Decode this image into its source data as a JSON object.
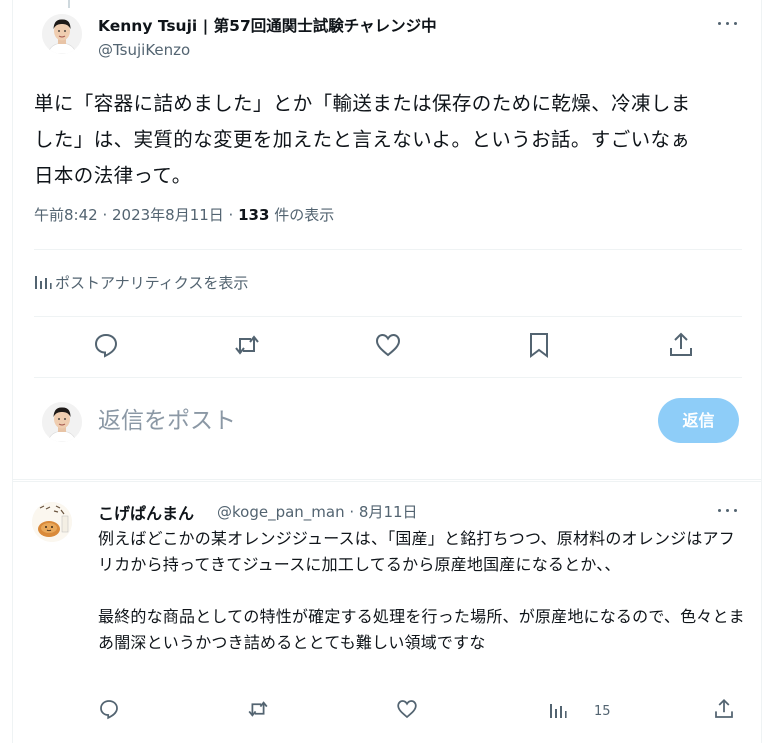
{
  "main_tweet": {
    "author_name": "Kenny Tsuji | 第57回通関士試験チャレンジ中",
    "author_handle": "@TsujiKenzo",
    "more_icon": "ellipsis-icon",
    "text_lines": [
      "単に「容器に詰めました」とか「輸送または保存のために乾燥、冷凍しま",
      "した」は、実質的な変更を加えたと言えないよ。というお話。すごいなぁ",
      "日本の法律って。"
    ],
    "time": "午前8:42 · 2023年8月11日 · ",
    "view_count": "133",
    "view_suffix": " 件の表示",
    "analytics_label": "ポストアナリティクスを表示",
    "actions": [
      "reply-icon",
      "repost-icon",
      "like-icon",
      "bookmark-icon",
      "share-icon"
    ]
  },
  "reply_composer": {
    "placeholder": "返信をポスト",
    "button_label": "返信",
    "button_color": "#8ecdf8"
  },
  "reply_tweet": {
    "author_name": "こげぱんまん",
    "author_handle": "@koge_pan_man · 8月11日",
    "paragraphs": [
      "例えばどこかの某オレンジジュースは、「国産」と銘打ちつつ、原材料のオレンジはアフリカから持ってきてジュースに加工してるから原産地国産になるとか、、",
      "最終的な商品としての特性が確定する処理を行った場所、が原産地になるので、色々とまあ闇深というかつき詰めるととても難しい領域ですな"
    ],
    "view_count": "15"
  },
  "colors": {
    "text": "#0f1419",
    "secondary": "#536471",
    "border": "#eff3f4",
    "accent": "#1d9bf0"
  }
}
